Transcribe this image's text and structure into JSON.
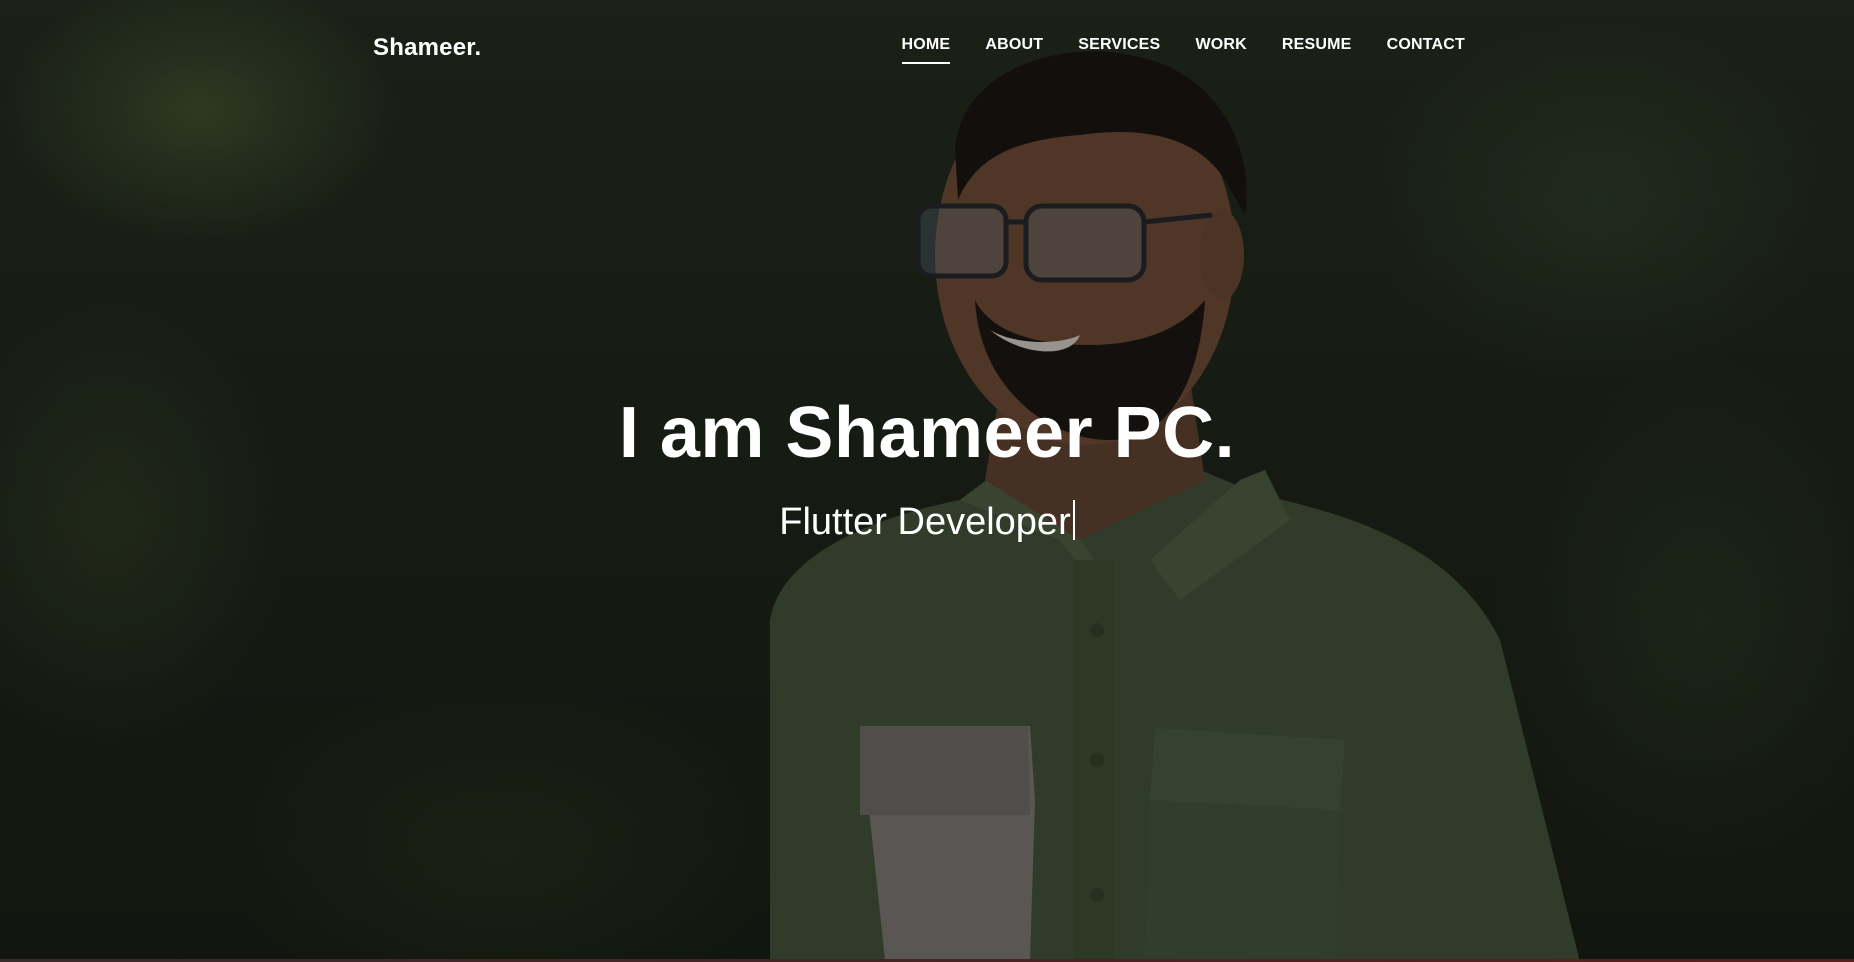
{
  "nav": {
    "brand": "Shameer.",
    "items": [
      {
        "label": "HOME",
        "active": true
      },
      {
        "label": "ABOUT",
        "active": false
      },
      {
        "label": "SERVICES",
        "active": false
      },
      {
        "label": "WORK",
        "active": false
      },
      {
        "label": "RESUME",
        "active": false
      },
      {
        "label": "CONTACT",
        "active": false
      }
    ]
  },
  "hero": {
    "title": "I am Shameer PC.",
    "subtitle": "Flutter Developer",
    "background_image": "portrait-photo",
    "colors": {
      "shirt": "#4b5d3f",
      "pocket": "#8a8580",
      "text": "#ffffff"
    }
  }
}
